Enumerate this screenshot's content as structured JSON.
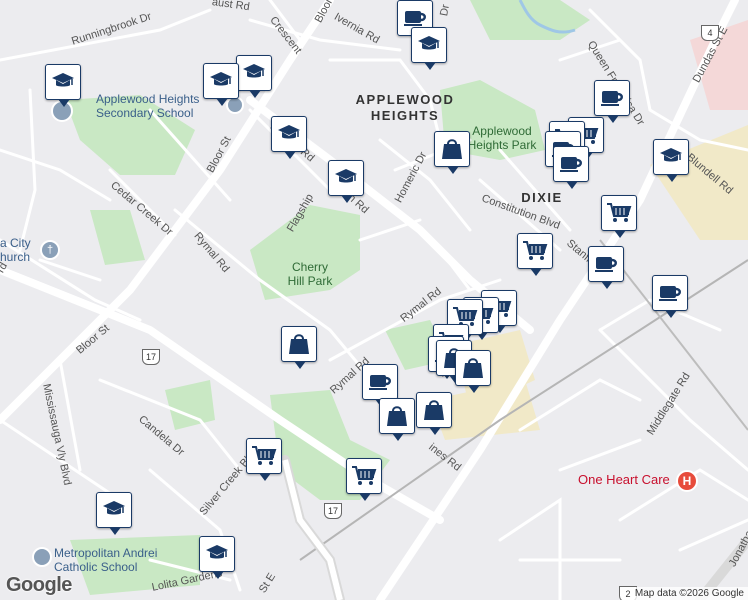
{
  "map": {
    "neighborhoods": [
      {
        "id": "applewood",
        "line1": "APPLEWOOD",
        "line2": "HEIGHTS"
      },
      {
        "id": "dixie",
        "line1": "DIXIE",
        "line2": ""
      }
    ],
    "parks": [
      {
        "id": "applewood-heights-park",
        "line1": "Applewood",
        "line2": "Heights Park"
      },
      {
        "id": "cherry-hill-park",
        "line1": "Cherry",
        "line2": "Hill Park"
      }
    ],
    "pois": [
      {
        "id": "applewood-heights-ss",
        "line1": "Applewood Heights",
        "line2": "Secondary School"
      },
      {
        "id": "metropolitan-andrei",
        "line1": "Metropolitan Andrei",
        "line2": "Catholic School"
      },
      {
        "id": "city-church",
        "line1": "a City",
        "line2": "hurch"
      },
      {
        "id": "one-heart-care",
        "line1": "One Heart Care",
        "line2": ""
      }
    ],
    "streets": {
      "runningbrook": "Runningbrook Dr",
      "aust": "aust Rd",
      "crescent": "Crescent",
      "bloor_top": "Bloor",
      "ivernia": "Ivernia Rd",
      "dr_top": "Dr",
      "queen_frederica": "Queen Frederica Dr",
      "dundas_e": "Dundas St E",
      "bloor_st": "Bloor St",
      "tomken": "Tomken Rd",
      "en_rd": "en Rd",
      "flagship": "Flagship",
      "homeric": "Homeric Dr",
      "constitution": "Constitution Blvd",
      "blundell": "Blundell Rd",
      "cedar_creek": "Cedar Creek Dr",
      "rymal_1": "Rymal Rd",
      "rymal_2": "Rymal Rd",
      "rymal_3": "Rymal Rd",
      "bloor_st_lower": "Bloor St",
      "mississauga_vly": "Mississauga Vly Blvd",
      "candela": "Candela Dr",
      "silver_creek": "Silver Creek Blvd",
      "lolita": "Lolita Gardens",
      "st_e": "St E",
      "middlegate": "Middlegate Rd",
      "stanfield": "Stanfi",
      "ines": "ines Rd",
      "d_frag": "D",
      "rd_left": "rd",
      "jonathan": "Jonathan Dr"
    },
    "shields": {
      "top_right": "4",
      "route17_mid": "17",
      "route17_low": "17",
      "bottom": "2"
    },
    "google_logo": "Google",
    "attribution": "Map data ©2026 Google"
  }
}
